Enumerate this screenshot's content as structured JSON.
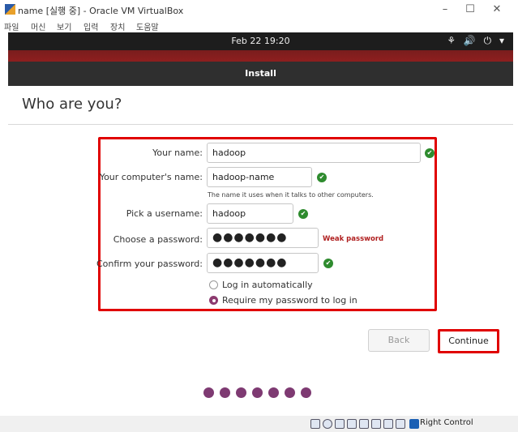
{
  "vbox": {
    "title": "name [실행 중] - Oracle VM VirtualBox",
    "minimize": "–",
    "maximize": "☐",
    "close": "✕",
    "menu": [
      "파일",
      "머신",
      "보기",
      "입력",
      "장치",
      "도움말"
    ],
    "host_key": "Right Control"
  },
  "topbar": {
    "clock": "Feb 22  19:20",
    "tray": "⚘ 🔊 ⏻ ▾"
  },
  "installer": {
    "window_title": "Install",
    "heading": "Who are you?"
  },
  "form": {
    "name_label": "Your name:",
    "name_value": "hadoop",
    "computer_label": "Your computer's name:",
    "computer_value": "hadoop-name",
    "computer_hint": "The name it uses when it talks to other computers.",
    "username_label": "Pick a username:",
    "username_value": "hadoop",
    "password_label": "Choose a password:",
    "password_value": "●●●●●●●",
    "password_strength": "Weak password",
    "confirm_label": "Confirm your password:",
    "confirm_value": "●●●●●●●",
    "login_auto_label": "Log in automatically",
    "login_auto_checked": false,
    "require_pw_label": "Require my password to log in",
    "require_pw_checked": true,
    "ok_mark": "✔"
  },
  "buttons": {
    "back": "Back",
    "continue": "Continue"
  },
  "progress": {
    "steps": 7
  },
  "colors": {
    "accent": "#7e3a72",
    "highlight": "#e00000",
    "ok": "#2e8b2e"
  }
}
